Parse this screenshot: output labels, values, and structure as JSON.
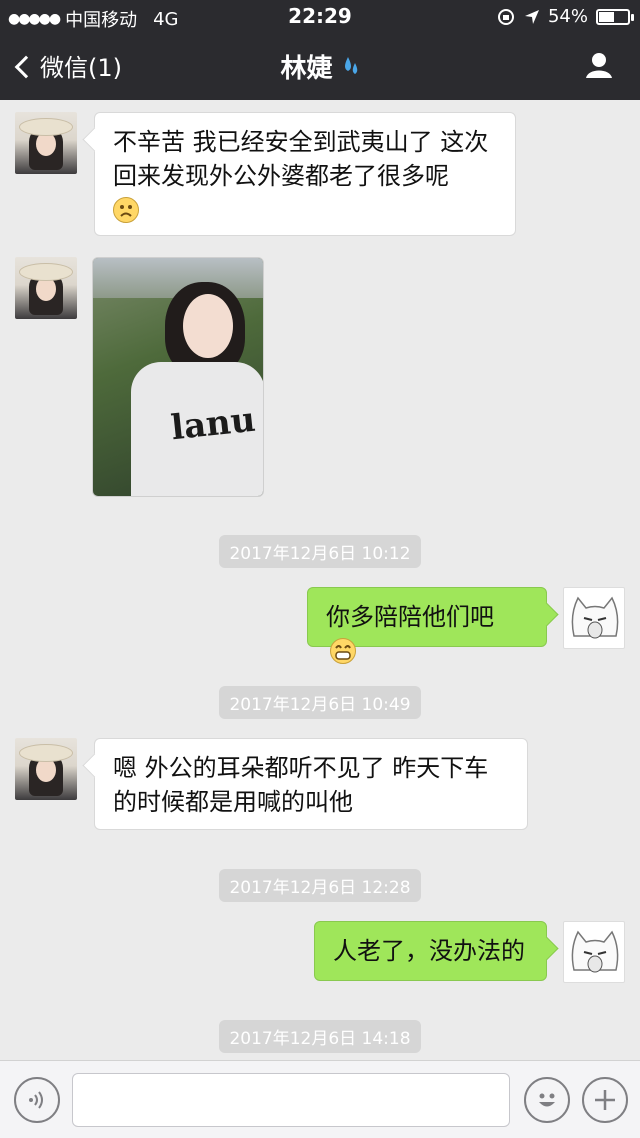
{
  "status_bar": {
    "carrier": "中国移动",
    "network": "4G",
    "time": "22:29",
    "battery": "54%",
    "battery_level": 0.54
  },
  "nav": {
    "back_label": "微信(1)",
    "title": "林婕"
  },
  "messages": [
    {
      "from": "contact",
      "text": "不辛苦   我已经安全到武夷山了  这次回来发现外公外婆都老了很多呢",
      "emoji": "sad-face-emoji"
    },
    {
      "from": "contact",
      "type": "photo",
      "image": "selfie-in-field"
    },
    {
      "type": "timestamp",
      "text": "2017年12月6日 10:12"
    },
    {
      "from": "me",
      "text": "你多陪陪他们吧",
      "emoji": "grin-emoji"
    },
    {
      "type": "timestamp",
      "text": "2017年12月6日 10:49"
    },
    {
      "from": "contact",
      "text": "嗯   外公的耳朵都听不见了 昨天下车的时候都是用喊的叫他"
    },
    {
      "type": "timestamp",
      "text": "2017年12月6日 12:28"
    },
    {
      "from": "me",
      "text": "人老了，没办法的"
    },
    {
      "type": "timestamp",
      "text": "2017年12月6日 14:18"
    }
  ],
  "input_bar": {
    "icons": [
      "voice-icon",
      "emoji-icon",
      "plus-icon"
    ]
  },
  "colors": {
    "nav_bg": "#2b2b2f",
    "chat_bg": "#ebebeb",
    "outgoing_bubble": "#9fe65a",
    "incoming_bubble": "#ffffff"
  }
}
